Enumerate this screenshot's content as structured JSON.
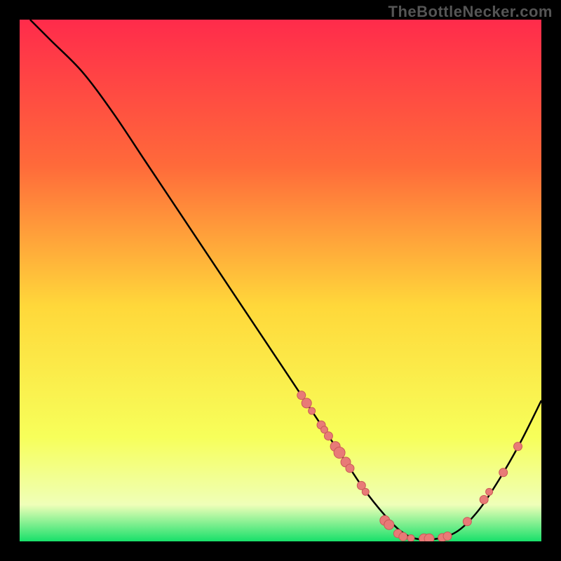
{
  "watermark": "TheBottleNecker.com",
  "colors": {
    "background": "#000000",
    "curve": "#000000",
    "marker_fill": "#e87a77",
    "marker_stroke": "#c95a57",
    "gradient_top": "#ff2b4b",
    "gradient_upper": "#ff6a3a",
    "gradient_mid": "#ffd83a",
    "gradient_lower": "#f7ff5a",
    "gradient_band": "#efffb8",
    "gradient_bottom": "#18e06a"
  },
  "chart_data": {
    "type": "line",
    "title": "",
    "xlabel": "",
    "ylabel": "",
    "xlim": [
      0,
      100
    ],
    "ylim": [
      0,
      100
    ],
    "series": [
      {
        "name": "curve",
        "x": [
          2,
          6,
          12,
          18,
          24,
          30,
          36,
          42,
          48,
          54,
          58,
          62,
          66,
          70,
          73,
          76,
          80,
          84,
          88,
          92,
          96,
          100
        ],
        "y": [
          100,
          96,
          90,
          82,
          73,
          64,
          55,
          46,
          37,
          28,
          22,
          16,
          10,
          5,
          2,
          0.5,
          0.5,
          2,
          6,
          12,
          19,
          27
        ]
      }
    ],
    "markers": [
      {
        "x": 54.0,
        "y": 28.0,
        "r": 6
      },
      {
        "x": 55.0,
        "y": 26.5,
        "r": 7
      },
      {
        "x": 56.0,
        "y": 25.0,
        "r": 5
      },
      {
        "x": 57.8,
        "y": 22.3,
        "r": 6
      },
      {
        "x": 58.4,
        "y": 21.4,
        "r": 5
      },
      {
        "x": 59.2,
        "y": 20.2,
        "r": 6
      },
      {
        "x": 60.5,
        "y": 18.2,
        "r": 7
      },
      {
        "x": 61.3,
        "y": 17.0,
        "r": 8
      },
      {
        "x": 62.5,
        "y": 15.2,
        "r": 7
      },
      {
        "x": 63.3,
        "y": 14.0,
        "r": 6
      },
      {
        "x": 65.5,
        "y": 10.7,
        "r": 6
      },
      {
        "x": 66.3,
        "y": 9.5,
        "r": 5
      },
      {
        "x": 70.0,
        "y": 4.0,
        "r": 7
      },
      {
        "x": 70.8,
        "y": 3.2,
        "r": 7
      },
      {
        "x": 72.5,
        "y": 1.5,
        "r": 6
      },
      {
        "x": 73.5,
        "y": 0.9,
        "r": 6
      },
      {
        "x": 75.0,
        "y": 0.6,
        "r": 5
      },
      {
        "x": 77.5,
        "y": 0.5,
        "r": 7
      },
      {
        "x": 78.5,
        "y": 0.5,
        "r": 7
      },
      {
        "x": 81.0,
        "y": 0.7,
        "r": 6
      },
      {
        "x": 82.0,
        "y": 1.0,
        "r": 6
      },
      {
        "x": 85.8,
        "y": 3.8,
        "r": 6
      },
      {
        "x": 89.0,
        "y": 8.0,
        "r": 6
      },
      {
        "x": 90.0,
        "y": 9.5,
        "r": 5
      },
      {
        "x": 92.7,
        "y": 13.2,
        "r": 6
      },
      {
        "x": 95.5,
        "y": 18.2,
        "r": 6
      }
    ]
  }
}
